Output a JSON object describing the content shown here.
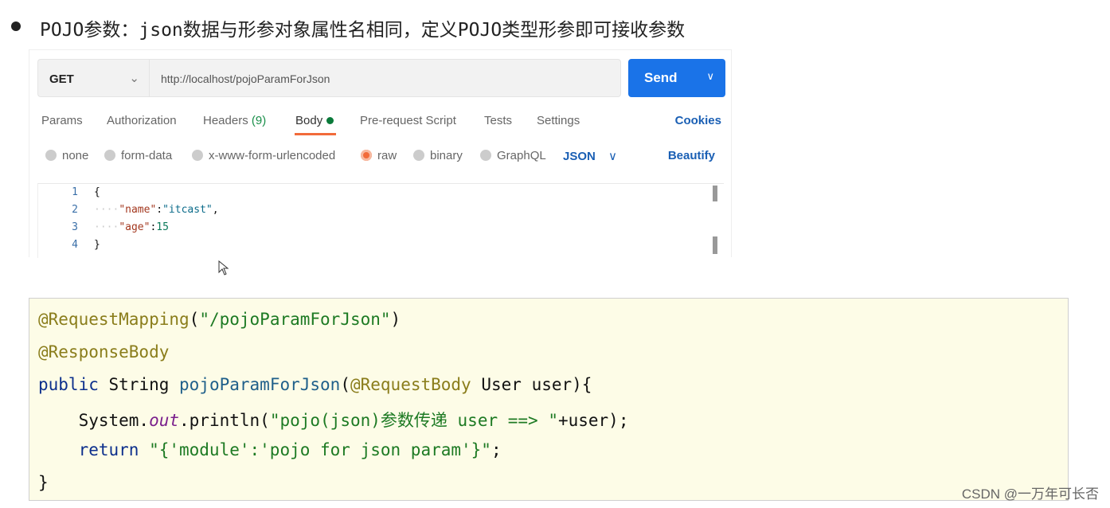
{
  "heading": "POJO参数：json数据与形参对象属性名相同，定义POJO类型形参即可接收参数",
  "postman": {
    "method": "GET",
    "url": "http://localhost/pojoParamForJson",
    "send": "Send",
    "tabs": [
      {
        "label": "Params"
      },
      {
        "label": "Authorization"
      },
      {
        "label": "Headers",
        "count": "(9)"
      },
      {
        "label": "Body",
        "active": true
      },
      {
        "label": "Pre-request Script"
      },
      {
        "label": "Tests"
      },
      {
        "label": "Settings"
      }
    ],
    "cookies": "Cookies",
    "body_types": [
      {
        "label": "none"
      },
      {
        "label": "form-data"
      },
      {
        "label": "x-www-form-urlencoded"
      },
      {
        "label": "raw",
        "selected": true
      },
      {
        "label": "binary"
      },
      {
        "label": "GraphQL"
      }
    ],
    "format": "JSON",
    "beautify": "Beautify",
    "editor_lines": [
      {
        "n": "1",
        "tokens": [
          {
            "t": "{",
            "c": "plain"
          }
        ]
      },
      {
        "n": "2",
        "tokens": [
          {
            "t": "····",
            "c": "ws"
          },
          {
            "t": "\"name\"",
            "c": "k"
          },
          {
            "t": ":",
            "c": "plain"
          },
          {
            "t": "\"itcast\"",
            "c": "s"
          },
          {
            "t": ",",
            "c": "plain"
          }
        ]
      },
      {
        "n": "3",
        "tokens": [
          {
            "t": "····",
            "c": "ws"
          },
          {
            "t": "\"age\"",
            "c": "k"
          },
          {
            "t": ":",
            "c": "plain"
          },
          {
            "t": "15",
            "c": "n"
          }
        ]
      },
      {
        "n": "4",
        "tokens": [
          {
            "t": "}",
            "c": "plain"
          }
        ]
      }
    ]
  },
  "code_lines": [
    [
      {
        "t": "@RequestMapping",
        "c": "ann"
      },
      {
        "t": "(",
        "c": "plain"
      },
      {
        "t": "\"/pojoParamForJson\"",
        "c": "str"
      },
      {
        "t": ")",
        "c": "plain"
      }
    ],
    [
      {
        "t": "@ResponseBody",
        "c": "ann"
      }
    ],
    [
      {
        "t": "public ",
        "c": "kw"
      },
      {
        "t": "String ",
        "c": "plain"
      },
      {
        "t": "pojoParamForJson",
        "c": "meth"
      },
      {
        "t": "(",
        "c": "plain"
      },
      {
        "t": "@RequestBody ",
        "c": "ann"
      },
      {
        "t": "User user){",
        "c": "plain"
      }
    ],
    [
      {
        "t": "    System.",
        "c": "plain"
      },
      {
        "t": "out",
        "c": "fld"
      },
      {
        "t": ".println(",
        "c": "plain"
      },
      {
        "t": "\"pojo(json)参数传递 user ==> \"",
        "c": "str"
      },
      {
        "t": "+user);",
        "c": "plain"
      }
    ],
    [
      {
        "t": "    return ",
        "c": "kw"
      },
      {
        "t": "\"{'module':'pojo for json param'}\"",
        "c": "str"
      },
      {
        "t": ";",
        "c": "plain"
      }
    ],
    [
      {
        "t": "}",
        "c": "plain"
      }
    ]
  ],
  "watermark": "CSDN @一万年可长否"
}
